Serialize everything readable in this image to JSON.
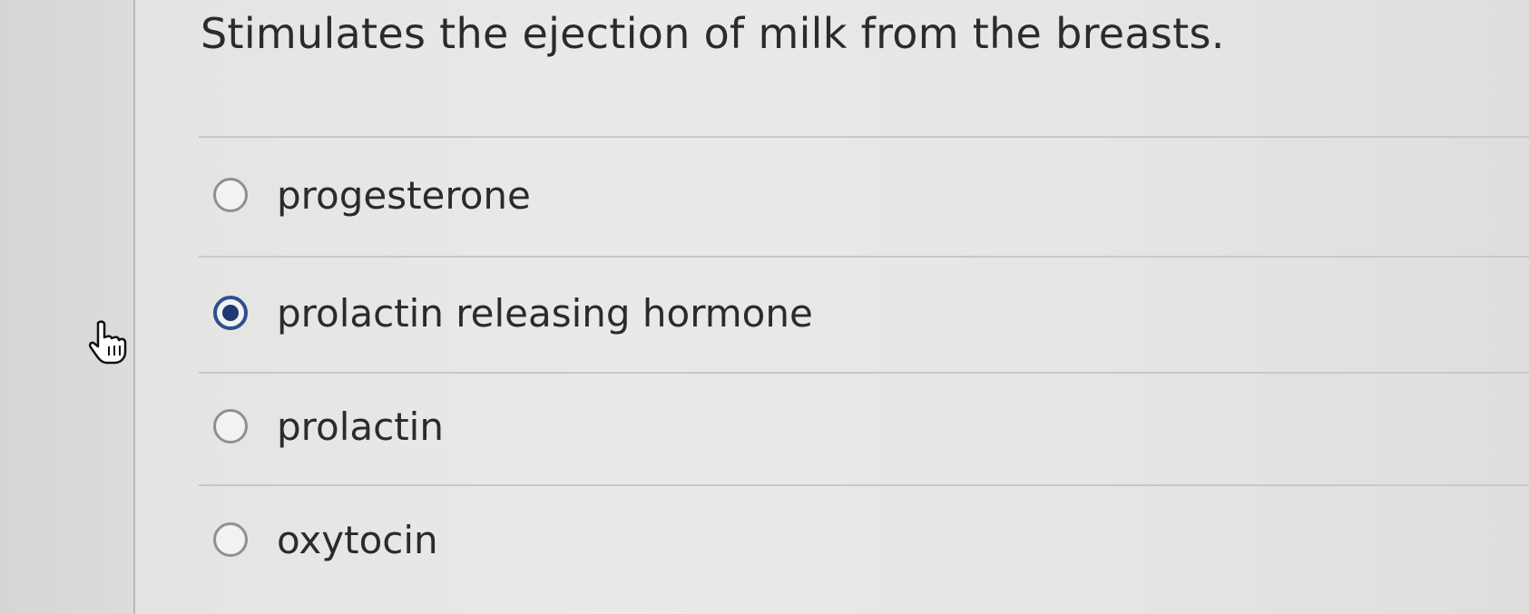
{
  "question": {
    "text": "Stimulates the ejection of milk from the breasts."
  },
  "options": [
    {
      "label": "progesterone",
      "selected": false
    },
    {
      "label": "prolactin releasing hormone",
      "selected": true
    },
    {
      "label": "prolactin",
      "selected": false
    },
    {
      "label": "oxytocin",
      "selected": false
    }
  ],
  "colors": {
    "radio_selected": "#1d3a73",
    "text": "#2b2b2b"
  },
  "cursor": {
    "icon": "hand-pointer-icon"
  }
}
